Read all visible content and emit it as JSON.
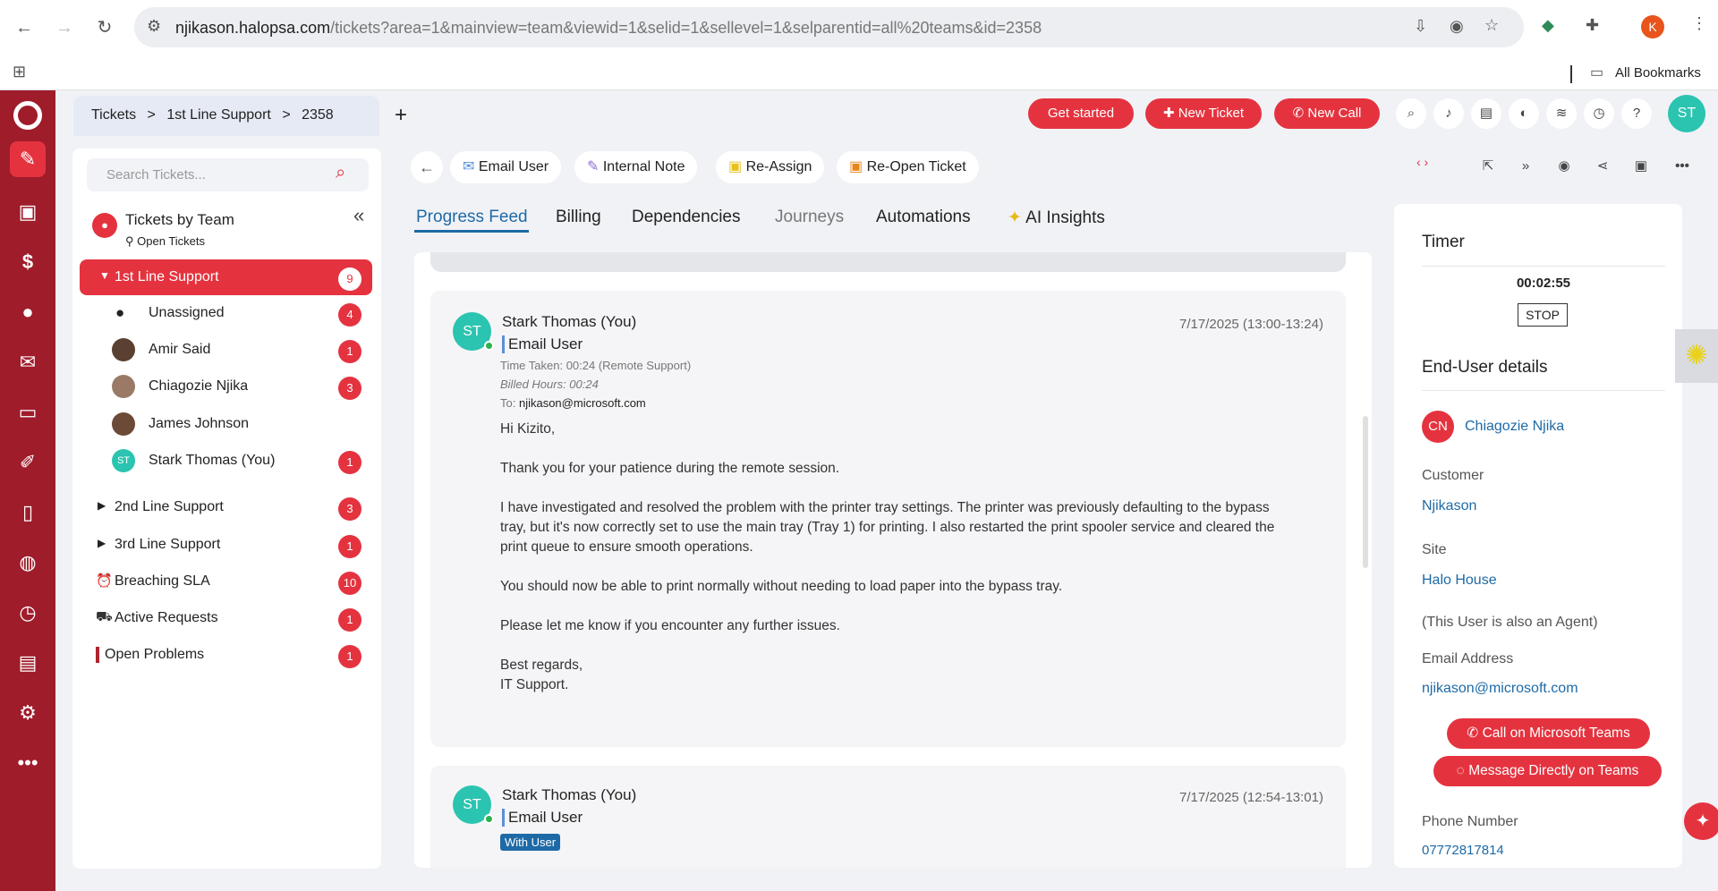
{
  "browser": {
    "url_host": "njikason.halopsa.com",
    "url_path": "/tickets?area=1&mainview=team&viewid=1&selid=1&sellevel=1&selparentid=all%20teams&id=2358",
    "profile_initial": "K",
    "bookmarks_label": "All Bookmarks"
  },
  "breadcrumb": {
    "root": "Tickets",
    "team": "1st Line Support",
    "ticket": "2358",
    "sep": ">"
  },
  "header": {
    "get_started": "Get started",
    "new_ticket": "New Ticket",
    "new_call": "New Call",
    "user_initials": "ST"
  },
  "sidebar": {
    "search_placeholder": "Search Tickets...",
    "title": "Tickets by Team",
    "filter": "Open Tickets",
    "items": [
      {
        "label": "1st Line Support",
        "count": "9"
      },
      {
        "label": "Unassigned",
        "count": "4"
      },
      {
        "label": "Amir Said",
        "count": "1"
      },
      {
        "label": "Chiagozie Njika",
        "count": "3"
      },
      {
        "label": "James Johnson",
        "count": ""
      },
      {
        "label": "Stark Thomas (You)",
        "count": "1"
      },
      {
        "label": "2nd Line Support",
        "count": "3"
      },
      {
        "label": "3rd Line Support",
        "count": "1"
      },
      {
        "label": "Breaching SLA",
        "count": "10"
      },
      {
        "label": "Active Requests",
        "count": "1"
      },
      {
        "label": "Open Problems",
        "count": "1"
      }
    ]
  },
  "actions": {
    "email_user": "Email User",
    "internal_note": "Internal Note",
    "reassign": "Re-Assign",
    "reopen": "Re-Open Ticket"
  },
  "tabs": [
    "Progress Feed",
    "Billing",
    "Dependencies",
    "Journeys",
    "Automations",
    "AI Insights"
  ],
  "feed": [
    {
      "initials": "ST",
      "author": "Stark Thomas (You)",
      "action": "Email User",
      "date": "7/17/2025 (13:00-13:24)",
      "time_taken": "Time Taken: 00:24 (Remote Support)",
      "billed": "Billed Hours: 00:24",
      "to_label": "To:",
      "to": "njikason@microsoft.com",
      "greeting": "Hi Kizito,",
      "p1": "Thank you for your patience during the remote session.",
      "p2a": "I have investigated and resolved the problem with the printer tray settings. The printer was previously defaulting to the bypass",
      "p2b": "tray, but it's now correctly set to use the main tray (Tray 1) for printing. I also restarted the print spooler service and cleared the",
      "p2c": "print queue to ensure smooth operations.",
      "p3": "You should now be able to print normally without needing to load paper into the bypass tray.",
      "p4": "Please let me know if you encounter any further issues.",
      "sign1": "Best regards,",
      "sign2": "IT Support."
    },
    {
      "initials": "ST",
      "author": "Stark Thomas (You)",
      "action": "Email User",
      "date": "7/17/2025 (12:54-13:01)",
      "badge": "With User"
    }
  ],
  "timer": {
    "title": "Timer",
    "time": "00:02:55",
    "stop": "STOP"
  },
  "enduser": {
    "title": "End-User details",
    "initials": "CN",
    "name": "Chiagozie Njika",
    "customer_label": "Customer",
    "customer": "Njikason",
    "site_label": "Site",
    "site": "Halo House",
    "agent_note": "(This User is also an Agent)",
    "email_label": "Email Address",
    "email": "njikason@microsoft.com",
    "call_teams": "Call on Microsoft Teams",
    "msg_teams": "Message Directly on Teams",
    "phone_label": "Phone Number",
    "phone": "07772817814"
  },
  "colors": {
    "brand": "#9f1c2b",
    "accent": "#e4333f",
    "link": "#1e6aa6",
    "avatar": "#2bc4b0"
  }
}
